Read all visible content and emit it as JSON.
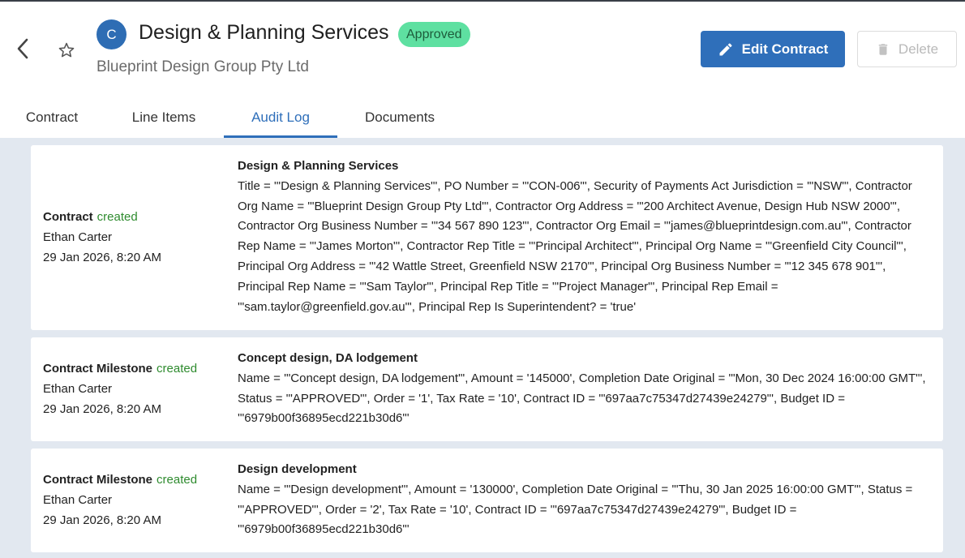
{
  "header": {
    "avatar_letter": "C",
    "title": "Design & Planning Services",
    "status_badge": "Approved",
    "subtitle": "Blueprint Design Group Pty Ltd",
    "edit_label": "Edit Contract",
    "delete_label": "Delete"
  },
  "tabs": [
    {
      "label": "Contract"
    },
    {
      "label": "Line Items"
    },
    {
      "label": "Audit Log",
      "active": true
    },
    {
      "label": "Documents"
    }
  ],
  "colors": {
    "primary": "#2f6fba",
    "badge": "#5ee0a1",
    "created": "#2e8b2e",
    "background": "#e2e8f0"
  },
  "audit_log": [
    {
      "entity": "Contract",
      "action": "created",
      "user": "Ethan Carter",
      "timestamp": "29 Jan 2026, 8:20 AM",
      "title": "Design & Planning Services",
      "details": "Title = '\"Design & Planning Services\"', PO Number = '\"CON-006\"', Security of Payments Act Jurisdiction = '\"NSW\"', Contractor Org Name = '\"Blueprint Design Group Pty Ltd\"', Contractor Org Address = '\"200 Architect Avenue, Design Hub NSW 2000\"', Contractor Org Business Number = '\"34 567 890 123\"', Contractor Org Email = '\"james@blueprintdesign.com.au\"', Contractor Rep Name = '\"James Morton\"', Contractor Rep Title = '\"Principal Architect\"', Principal Org Name = '\"Greenfield City Council\"', Principal Org Address = '\"42 Wattle Street, Greenfield NSW 2170\"', Principal Org Business Number = '\"12 345 678 901\"', Principal Rep Name = '\"Sam Taylor\"', Principal Rep Title = '\"Project Manager\"', Principal Rep Email = '\"sam.taylor@greenfield.gov.au\"', Principal Rep Is Superintendent? = 'true'"
    },
    {
      "entity": "Contract Milestone",
      "action": "created",
      "user": "Ethan Carter",
      "timestamp": "29 Jan 2026, 8:20 AM",
      "title": "Concept design, DA lodgement",
      "details": "Name = '\"Concept design, DA lodgement\"', Amount = '145000', Completion Date Original = '\"Mon, 30 Dec 2024 16:00:00 GMT\"', Status = '\"APPROVED\"', Order = '1', Tax Rate = '10', Contract ID = '\"697aa7c75347d27439e24279\"', Budget ID = '\"6979b00f36895ecd221b30d6\"'"
    },
    {
      "entity": "Contract Milestone",
      "action": "created",
      "user": "Ethan Carter",
      "timestamp": "29 Jan 2026, 8:20 AM",
      "title": "Design development",
      "details": "Name = '\"Design development\"', Amount = '130000', Completion Date Original = '\"Thu, 30 Jan 2025 16:00:00 GMT\"', Status = '\"APPROVED\"', Order = '2', Tax Rate = '10', Contract ID = '\"697aa7c75347d27439e24279\"', Budget ID = '\"6979b00f36895ecd221b30d6\"'"
    }
  ]
}
